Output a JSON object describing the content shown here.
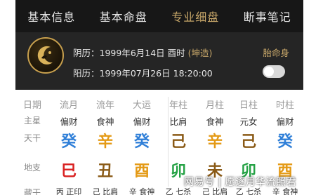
{
  "tabs": [
    {
      "label": "基本信息",
      "active": false
    },
    {
      "label": "基本命盘",
      "active": false
    },
    {
      "label": "专业细盘",
      "active": true
    },
    {
      "label": "断事笔记",
      "active": false
    }
  ],
  "profile": {
    "lunar_prefix": "阴历：",
    "lunar_date": "1999年6月14日 酉时",
    "lunar_tag": "(坤造)",
    "gender_tag": "胎命身",
    "solar_prefix": "阳历：",
    "solar_date": "1999年07月26日 18:20:00",
    "toggle_on": false
  },
  "row_labels": {
    "date": "日期",
    "star": "主星",
    "gan": "天干",
    "zhi": "地支",
    "hidden": "藏干"
  },
  "columns": [
    {
      "header": "流月",
      "star": "偏财",
      "gan": "癸",
      "gan_color": "#2f7fd8",
      "zhi": "巳",
      "zhi_color": "#d92121",
      "hidden": "丙 正印"
    },
    {
      "header": "流年",
      "star": "食神",
      "gan": "辛",
      "gan_color": "#e49a16",
      "zhi": "丑",
      "zhi_color": "#8a5a16",
      "hidden": "己 比肩"
    },
    {
      "header": "大运",
      "star": "偏财",
      "gan": "癸",
      "gan_color": "#2f7fd8",
      "zhi": "酉",
      "zhi_color": "#e49a16",
      "hidden": "辛 食神"
    },
    {
      "header": "年柱",
      "star": "比肩",
      "gan": "己",
      "gan_color": "#8a5a16",
      "zhi": "卯",
      "zhi_color": "#25a245",
      "hidden": "乙 七杀"
    },
    {
      "header": "月柱",
      "star": "食神",
      "gan": "辛",
      "gan_color": "#e49a16",
      "zhi": "未",
      "zhi_color": "#8a5a16",
      "hidden": "己 比肩"
    },
    {
      "header": "日柱",
      "star": "元女",
      "gan": "己",
      "gan_color": "#8a5a16",
      "zhi": "卯",
      "zhi_color": "#25a245",
      "hidden": "乙 七杀"
    },
    {
      "header": "时柱",
      "star": "偏财",
      "gan": "癸",
      "gan_color": "#2f7fd8",
      "zhi": "酉",
      "zhi_color": "#e49a16",
      "hidden": "辛 食神"
    }
  ],
  "watermark": "网易号 | 愿逐月华流照君"
}
